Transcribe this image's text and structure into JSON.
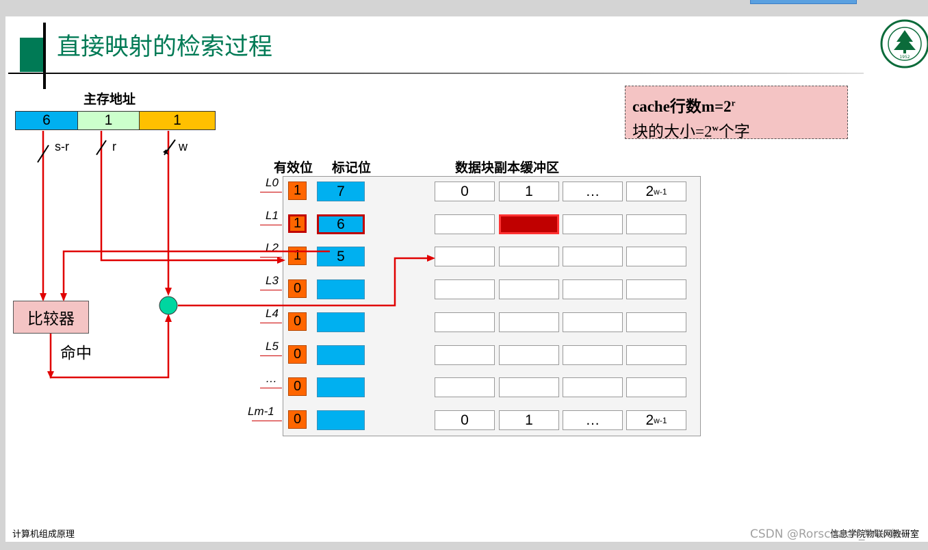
{
  "title": "直接映射的检索过程",
  "address": {
    "label": "主存地址",
    "segments": [
      {
        "value": "6",
        "color": "#00b0f0"
      },
      {
        "value": "1",
        "color": "#ccffcc"
      },
      {
        "value": "1",
        "color": "#ffc000"
      }
    ],
    "fields": [
      "s-r",
      "r",
      "w"
    ]
  },
  "info_box": {
    "line1_prefix": "cache行数m=2",
    "line1_sup": "r",
    "line2_prefix": "块的大小=2",
    "line2_sup": "w",
    "line2_suffix": "个字"
  },
  "headers": {
    "valid": "有效位",
    "tag": "标记位",
    "data": "数据块副本缓冲区"
  },
  "rows": [
    {
      "label": "L0",
      "valid": "1",
      "tag": "7",
      "data": [
        "0",
        "1",
        "…",
        "2"
      ],
      "data_sup": "w-1"
    },
    {
      "label": "L1",
      "valid": "1",
      "tag": "6",
      "data": [
        "",
        "",
        "",
        ""
      ],
      "highlight": true
    },
    {
      "label": "L2",
      "valid": "1",
      "tag": "5",
      "data": [
        "",
        "",
        "",
        ""
      ]
    },
    {
      "label": "L3",
      "valid": "0",
      "tag": "",
      "data": [
        "",
        "",
        "",
        ""
      ]
    },
    {
      "label": "L4",
      "valid": "0",
      "tag": "",
      "data": [
        "",
        "",
        "",
        ""
      ]
    },
    {
      "label": "L5",
      "valid": "0",
      "tag": "",
      "data": [
        "",
        "",
        "",
        ""
      ]
    },
    {
      "label": "…",
      "valid": "0",
      "tag": "",
      "data": [
        "",
        "",
        "",
        ""
      ]
    },
    {
      "label": "Lm-1",
      "valid": "0",
      "tag": "",
      "data": [
        "0",
        "1",
        "…",
        "2"
      ],
      "data_sup": "w-1"
    }
  ],
  "comparator": "比较器",
  "hit": "命中",
  "footer_left": "计算机组成原理",
  "footer_right": "信息学院物联网教研室",
  "watermark": "CSDN @Rorschach_Warden",
  "logo": {
    "text": "BEIJING FORESTRY UNIV",
    "year": "1952"
  },
  "colors": {
    "title": "#007a55",
    "accent_square": "#007a55",
    "wire": "#e00000",
    "valid": "#ff6600",
    "tag": "#00b0f0",
    "highlight": "#c00000",
    "info_bg": "#f4c4c4",
    "comparator_bg": "#f4c4c4",
    "circle": "#00d6a0"
  }
}
